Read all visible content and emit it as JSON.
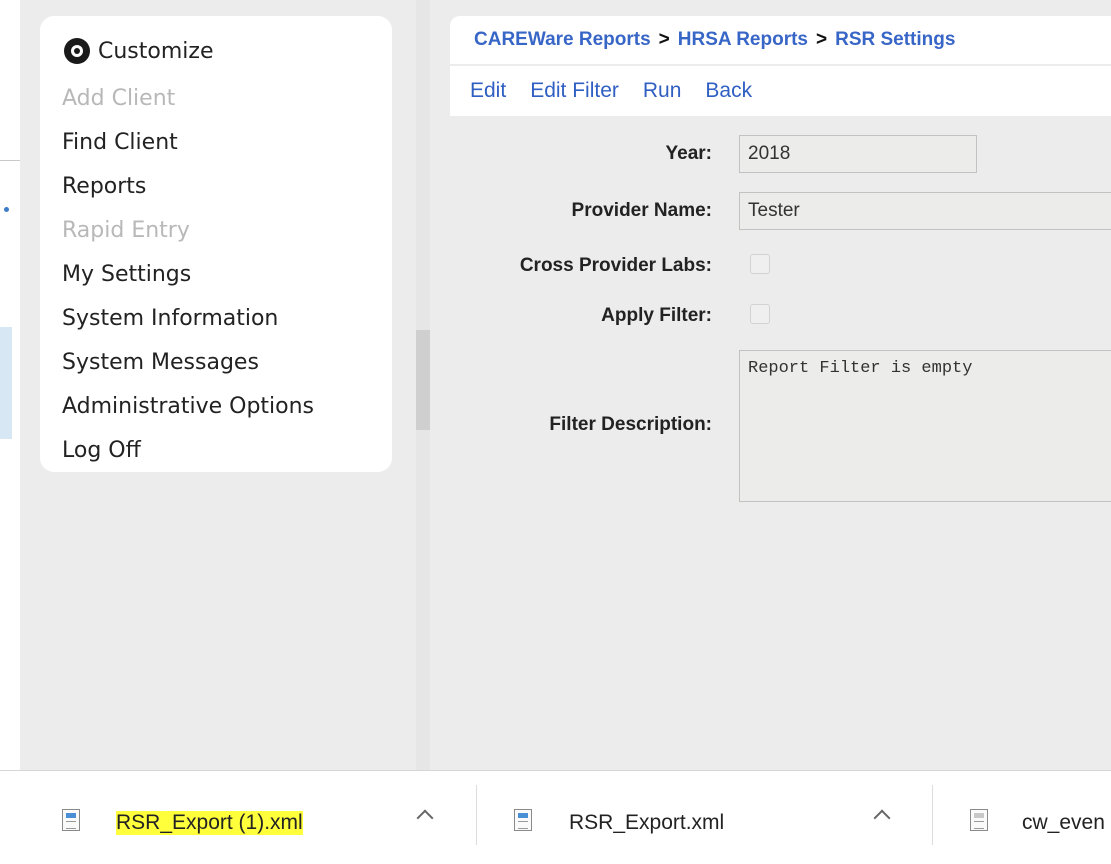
{
  "sidebar": {
    "header_label": "Customize",
    "items": [
      {
        "label": "Add Client",
        "enabled": false
      },
      {
        "label": "Find Client",
        "enabled": true
      },
      {
        "label": "Reports",
        "enabled": true
      },
      {
        "label": "Rapid Entry",
        "enabled": false
      },
      {
        "label": "My Settings",
        "enabled": true
      },
      {
        "label": "System Information",
        "enabled": true
      },
      {
        "label": "System Messages",
        "enabled": true
      },
      {
        "label": "Administrative Options",
        "enabled": true
      },
      {
        "label": "Log Off",
        "enabled": true
      }
    ]
  },
  "breadcrumb": {
    "items": [
      "CAREWare Reports",
      "HRSA Reports",
      "RSR Settings"
    ],
    "separator": ">"
  },
  "actions": [
    "Edit",
    "Edit Filter",
    "Run",
    "Back"
  ],
  "form": {
    "year_label": "Year:",
    "year_value": "2018",
    "provider_label": "Provider Name:",
    "provider_value": "Tester",
    "cross_labs_label": "Cross Provider Labs:",
    "cross_labs_checked": false,
    "apply_filter_label": "Apply Filter:",
    "apply_filter_checked": false,
    "filter_desc_label": "Filter Description:",
    "filter_desc_value": "Report Filter is empty"
  },
  "downloads": [
    {
      "name": "RSR_Export (1).xml",
      "icon": "xml-file-icon",
      "highlighted": true
    },
    {
      "name": "RSR_Export.xml",
      "icon": "xml-file-icon",
      "highlighted": false
    },
    {
      "name": "cw_even",
      "icon": "text-file-icon",
      "highlighted": false
    }
  ],
  "colors": {
    "link_blue": "#3866c7",
    "panel_gray": "#ececec",
    "highlight_yellow": "#ffff3c"
  }
}
